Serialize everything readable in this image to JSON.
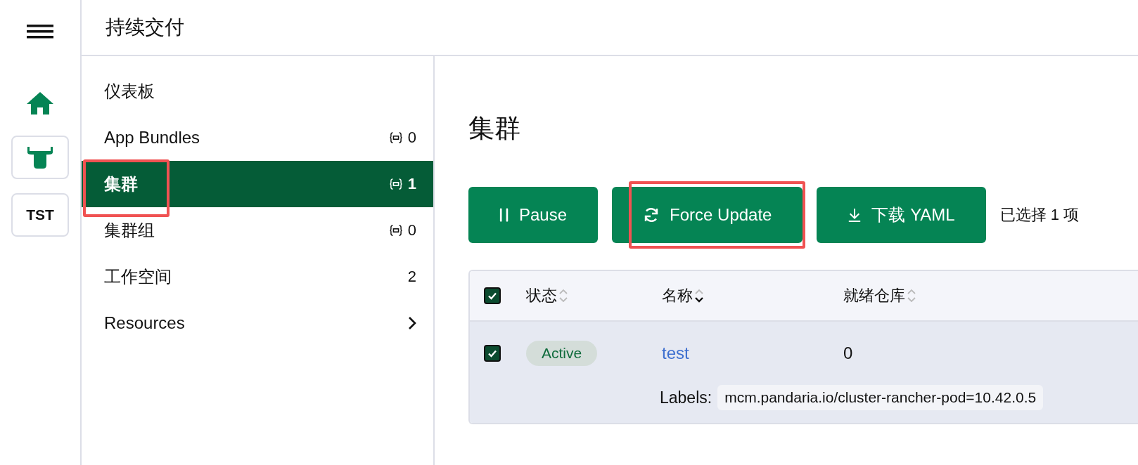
{
  "rail": {
    "items": [
      {
        "kind": "home"
      },
      {
        "kind": "logo"
      },
      {
        "kind": "text",
        "label": "TST"
      }
    ]
  },
  "header": {
    "title": "持续交付"
  },
  "nav": {
    "items": [
      {
        "label": "仪表板",
        "selected": false,
        "highlighted": false
      },
      {
        "label": "App Bundles",
        "count": "0",
        "count_icon": true,
        "selected": false,
        "highlighted": false
      },
      {
        "label": "集群",
        "count": "1",
        "count_icon": true,
        "selected": true,
        "highlighted": true
      },
      {
        "label": "集群组",
        "count": "0",
        "count_icon": true,
        "selected": false,
        "highlighted": false
      },
      {
        "label": "工作空间",
        "count": "2",
        "count_icon": false,
        "selected": false,
        "highlighted": false
      },
      {
        "label": "Resources",
        "chevron": true,
        "selected": false,
        "highlighted": false
      }
    ]
  },
  "page": {
    "title": "集群"
  },
  "actions": [
    {
      "kind": "pause",
      "label": "Pause",
      "highlighted": false
    },
    {
      "kind": "refresh",
      "label": "Force Update",
      "highlighted": true
    },
    {
      "kind": "download",
      "label": "下载 YAML",
      "highlighted": false
    }
  ],
  "selection_text": "已选择 1 项",
  "table": {
    "all_checked": true,
    "columns": [
      {
        "label": "状态",
        "sorted_desc": false
      },
      {
        "label": "名称",
        "sorted_desc": true
      },
      {
        "label": "就绪仓库",
        "sorted_desc": false
      }
    ],
    "rows": [
      {
        "checked": true,
        "status": "Active",
        "name": "test",
        "ready": "0",
        "labels_title": "Labels:",
        "label": "mcm.pandaria.io/cluster-rancher-pod=10.42.0.5"
      }
    ]
  }
}
